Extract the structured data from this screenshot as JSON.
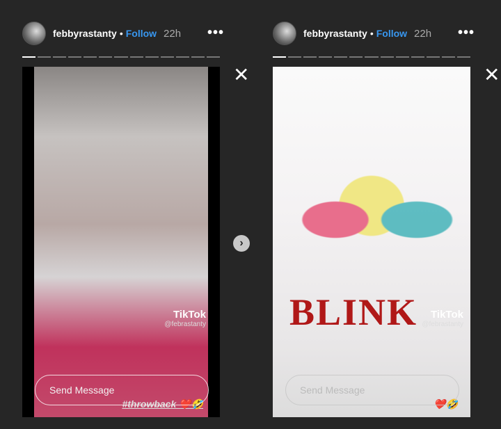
{
  "stories": [
    {
      "username": "febbyrastanty",
      "follow": "Follow",
      "time": "22h",
      "tiktok": "TikTok",
      "tiktok_handle": "@febrastanty",
      "caption": "#throwback ❤️🤣",
      "message_placeholder": "Send Message",
      "progress_segments": 13,
      "active_segment": 1
    },
    {
      "username": "febbyrastanty",
      "follow": "Follow",
      "time": "22h",
      "tiktok": "TikTok",
      "tiktok_handle": "@febrastanty",
      "logo_text": "BLINK",
      "caption": "❤️🤣",
      "message_placeholder": "Send Message",
      "progress_segments": 13,
      "active_segment": 1
    }
  ],
  "icons": {
    "more": "more-horizontal-icon",
    "close": "close-icon",
    "next": "chevron-right-icon"
  },
  "glyphs": {
    "more": "•••",
    "close": "✕",
    "next": "›",
    "dot": "•"
  },
  "colors": {
    "background": "#262626",
    "follow": "#3897f0"
  }
}
